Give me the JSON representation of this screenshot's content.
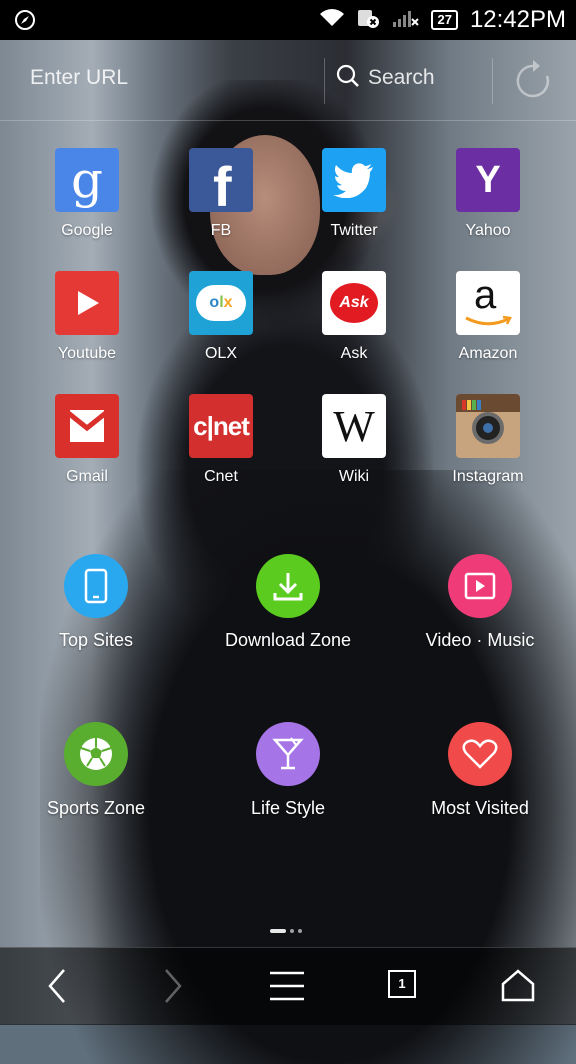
{
  "status_bar": {
    "time": "12:42PM",
    "battery": "27",
    "icons": [
      "compass-icon",
      "wifi-icon",
      "sim-card-icon",
      "signal-icon",
      "battery-icon"
    ]
  },
  "url_bar": {
    "url_placeholder": "Enter URL",
    "search_label": "Search",
    "refresh_icon": "refresh-icon"
  },
  "sites": [
    {
      "label": "Google",
      "color": "#4a86e8",
      "icon": "google-icon"
    },
    {
      "label": "FB",
      "color": "#3b5998",
      "icon": "facebook-icon"
    },
    {
      "label": "Twitter",
      "color": "#1da1f2",
      "icon": "twitter-icon"
    },
    {
      "label": "Yahoo",
      "color": "#6b2fa3",
      "icon": "yahoo-icon"
    },
    {
      "label": "Youtube",
      "color": "#e53935",
      "icon": "youtube-icon"
    },
    {
      "label": "OLX",
      "color": "#1fa3d6",
      "icon": "olx-icon"
    },
    {
      "label": "Ask",
      "color": "#ffffff",
      "icon": "ask-icon"
    },
    {
      "label": "Amazon",
      "color": "#ffffff",
      "icon": "amazon-icon"
    },
    {
      "label": "Gmail",
      "color": "#d9302c",
      "icon": "gmail-icon"
    },
    {
      "label": "Cnet",
      "color": "#d32f2f",
      "icon": "cnet-icon"
    },
    {
      "label": "Wiki",
      "color": "#ffffff",
      "icon": "wikipedia-icon"
    },
    {
      "label": "Instagram",
      "color": "#c8a47e",
      "icon": "instagram-icon"
    }
  ],
  "zones": [
    {
      "label": "Top Sites",
      "color": "#29a8f0",
      "icon": "phone-icon"
    },
    {
      "label": "Download Zone",
      "color": "#5ccb1f",
      "icon": "download-icon"
    },
    {
      "label": "Video · Music",
      "color": "#ef3b78",
      "icon": "play-icon"
    },
    {
      "label": "Sports Zone",
      "color": "#5aae2f",
      "icon": "soccer-ball-icon"
    },
    {
      "label": "Life Style",
      "color": "#a574e6",
      "icon": "cocktail-glass-icon"
    },
    {
      "label": "Most Visited",
      "color": "#f04a4a",
      "icon": "heart-icon"
    }
  ],
  "pager": {
    "pages": 3,
    "current": 1
  },
  "toolbar": {
    "tab_count": "1",
    "icons": [
      "back-icon",
      "forward-icon",
      "menu-icon",
      "tabs-icon",
      "home-icon"
    ]
  }
}
